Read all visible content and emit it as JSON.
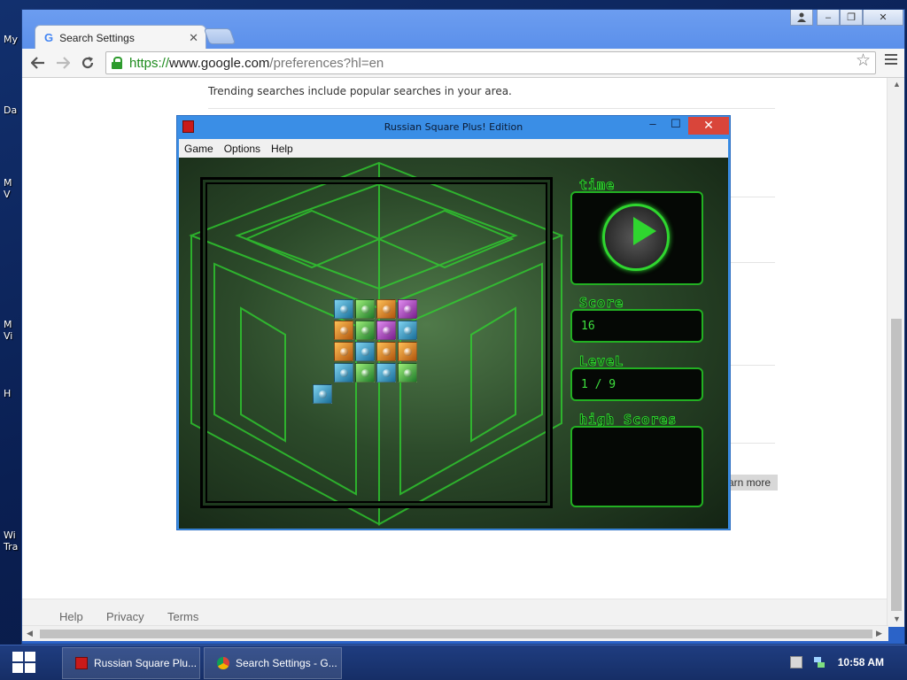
{
  "desktop": {
    "labels": [
      "My",
      "Da",
      "M\nV",
      "M\nVi",
      "H",
      "Wi\nTra"
    ]
  },
  "browser": {
    "tab_title": "Search Settings",
    "tab_favicon": "G",
    "url": {
      "scheme": "https://",
      "host": "www.google.com",
      "path": "/preferences?hl=en"
    },
    "page_text": "Trending searches include popular searches in your area.",
    "learn_more": "arn more",
    "footer": {
      "help": "Help",
      "privacy": "Privacy",
      "terms": "Terms"
    },
    "colors": {
      "accent": "#2b63c8",
      "https_green": "#1e8c1e"
    }
  },
  "game_window": {
    "title": "Russian Square Plus! Edition",
    "menu": [
      "Game",
      "Options",
      "Help"
    ],
    "buttons": {
      "minimize": "–",
      "maximize": "☐",
      "close": "✕"
    },
    "panels": {
      "time_label": "time",
      "score_label": "Score",
      "score_value": "16",
      "level_label": "LeveL",
      "level_value": "1 / 9",
      "high_scores_label": "high Scores"
    },
    "colors": {
      "glow": "#2fd62f"
    }
  },
  "taskbar": {
    "items": [
      {
        "label": "Russian Square Plu...",
        "icon": "red-cube-icon"
      },
      {
        "label": "Search Settings - G...",
        "icon": "chrome-icon"
      }
    ],
    "time": "10:58 AM"
  }
}
